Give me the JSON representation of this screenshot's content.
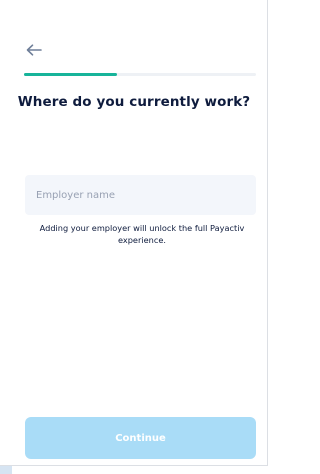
{
  "progress": {
    "fraction": 0.4
  },
  "title": "Where do you currently work?",
  "employer_input": {
    "placeholder": "Employer name",
    "value": ""
  },
  "hint": "Adding your employer will unlock the full Payactiv experience.",
  "continue_label": "Continue",
  "icons": {
    "back": "arrow-left-icon"
  },
  "colors": {
    "accent": "#17b49a",
    "title_text": "#0e1b3d",
    "button_disabled": "#a9dcf7",
    "input_bg": "#f3f6fb",
    "back_arrow": "#6f7f99"
  }
}
